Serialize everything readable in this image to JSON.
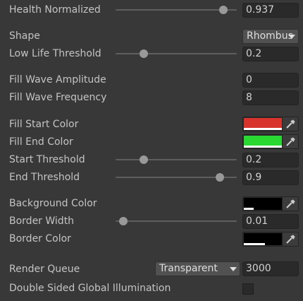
{
  "health": {
    "label": "Health Normalized",
    "value": "0.937",
    "level": 0.937
  },
  "shape": {
    "label": "Shape",
    "selected": "Rhombus"
  },
  "low_life": {
    "label": "Low Life Threshold",
    "value": "0.2",
    "level": 0.2
  },
  "wave_amp": {
    "label": "Fill Wave Amplitude",
    "value": "0"
  },
  "wave_freq": {
    "label": "Fill Wave Frequency",
    "value": "8"
  },
  "fill_start": {
    "label": "Fill Start Color",
    "color": "#d8342c",
    "alpha": 1.0
  },
  "fill_end": {
    "label": "Fill End Color",
    "color": "#2ad832",
    "alpha": 1.0
  },
  "start_threshold": {
    "label": "Start Threshold",
    "value": "0.2",
    "level": 0.2
  },
  "end_threshold": {
    "label": "End Threshold",
    "value": "0.9",
    "level": 0.9
  },
  "bg_color": {
    "label": "Background Color",
    "color": "#000000",
    "alpha": 0.25
  },
  "border_width": {
    "label": "Border Width",
    "value": "0.01",
    "level": 0.01
  },
  "border_color": {
    "label": "Border Color",
    "color": "#000000",
    "alpha": 0.55
  },
  "render_queue": {
    "label": "Render Queue",
    "mode": "Transparent",
    "value": "3000"
  },
  "double_sided": {
    "label": "Double Sided Global Illumination",
    "checked": false
  },
  "icons": {
    "picker": "eyedropper-icon",
    "dropdown": "chevron-down-icon"
  }
}
